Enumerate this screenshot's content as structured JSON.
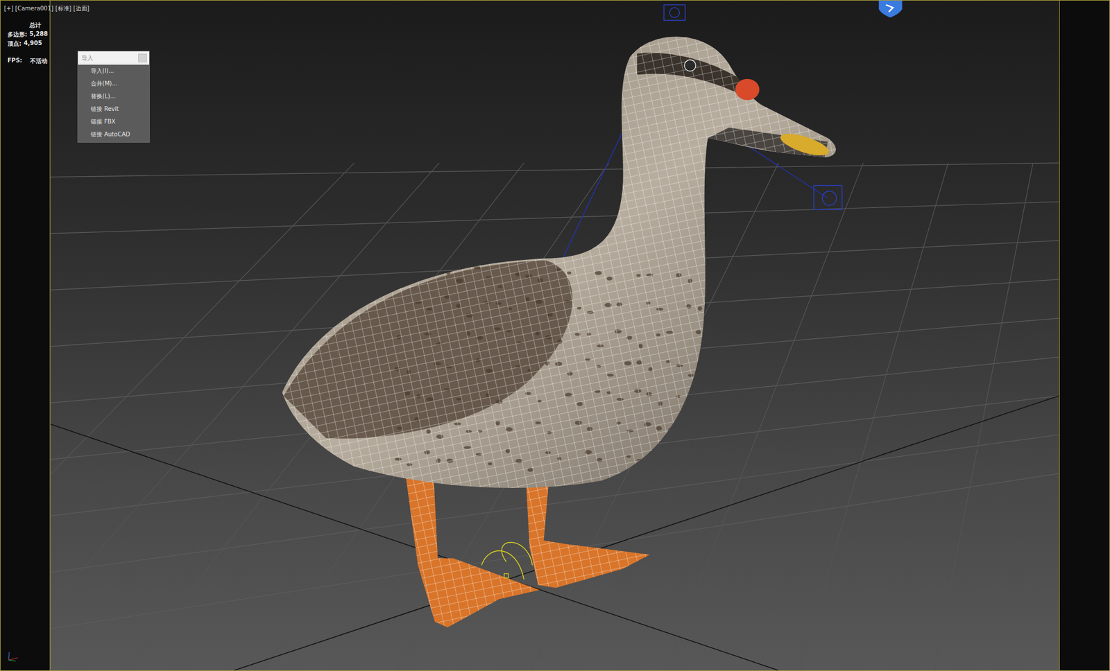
{
  "viewport": {
    "label": "[+] [Camera001] [标准] [边面]"
  },
  "stats": {
    "title": "总计",
    "rows": [
      {
        "label": "多边形:",
        "value": "5,288"
      },
      {
        "label": "顶点:",
        "value": "4,905"
      }
    ],
    "fps": {
      "label": "FPS:",
      "value": "不活动"
    }
  },
  "menu": {
    "title": "导入",
    "items": [
      "导入(I)...",
      "合并(M)...",
      "替换(L)...",
      "链接 Revit",
      "链接 FBX",
      "链接 AutoCAD"
    ]
  }
}
